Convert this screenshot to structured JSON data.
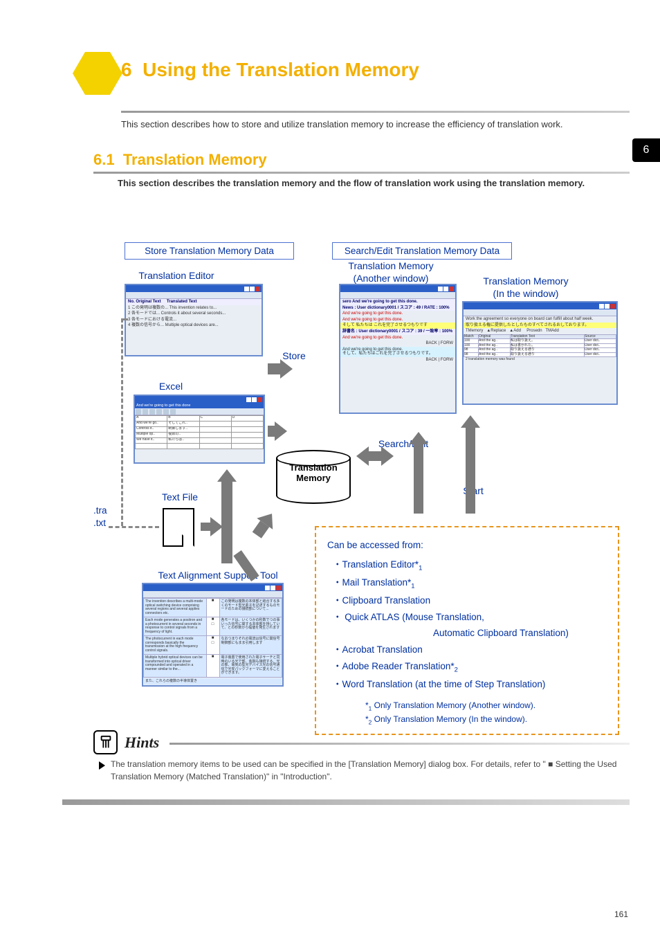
{
  "page": {
    "chapter_number": "6",
    "page_no_top": "6",
    "page_no_bottom": "161",
    "chapter_title": "Using the Translation Memory",
    "chapter_subtitle": "This section describes how to store and utilize translation memory to increase the efficiency of translation work.",
    "section_number": "6.1",
    "section_title": "Translation Memory",
    "section_lead": "This section describes the translation memory and the flow of translation work using the translation memory."
  },
  "diagram": {
    "store_box": "Store Translation Memory Data",
    "search_box": "Search/Edit Translation Memory Data",
    "translation_editor": "Translation Editor",
    "tm_another_line1": "Translation Memory",
    "tm_another_line2": "(Another window)",
    "tm_inwindow_line1": "Translation Memory",
    "tm_inwindow_line2": "(In the window)",
    "store_label": "Store",
    "excel_label": "Excel",
    "search_edit_label": "Search/Edit",
    "start_label": "Start",
    "text_file_label": "Text File",
    "alignment_tool_label": "Text Alignment Support Tool",
    "cylinder_line1": "Translation",
    "cylinder_line2": "Memory",
    "ext_tra": ".tra",
    "ext_txt": ".txt"
  },
  "access": {
    "title": "Can be accessed from:",
    "items": [
      "Translation Editor*1",
      "Mail Translation*1",
      "Clipboard Translation",
      "Quick ATLAS (Mouse Translation,",
      "Acrobat Translation",
      "Adobe Reader Translation*2",
      "Word  Translation (at the time of Step Translation)"
    ],
    "quick_atlas_cont": "Automatic Clipboard Translation)",
    "note1": "*1 Only Translation Memory (Another window).",
    "note2": "*2 Only Translation Memory (In the window)."
  },
  "hints": {
    "label": "Hints",
    "text": "The translation memory items to be used can be specified in the [Translation Memory] dialog box. For details, refer to \" ■ Setting the Used Translation Memory (Matched Translation)\" in \"Introduction\"."
  }
}
